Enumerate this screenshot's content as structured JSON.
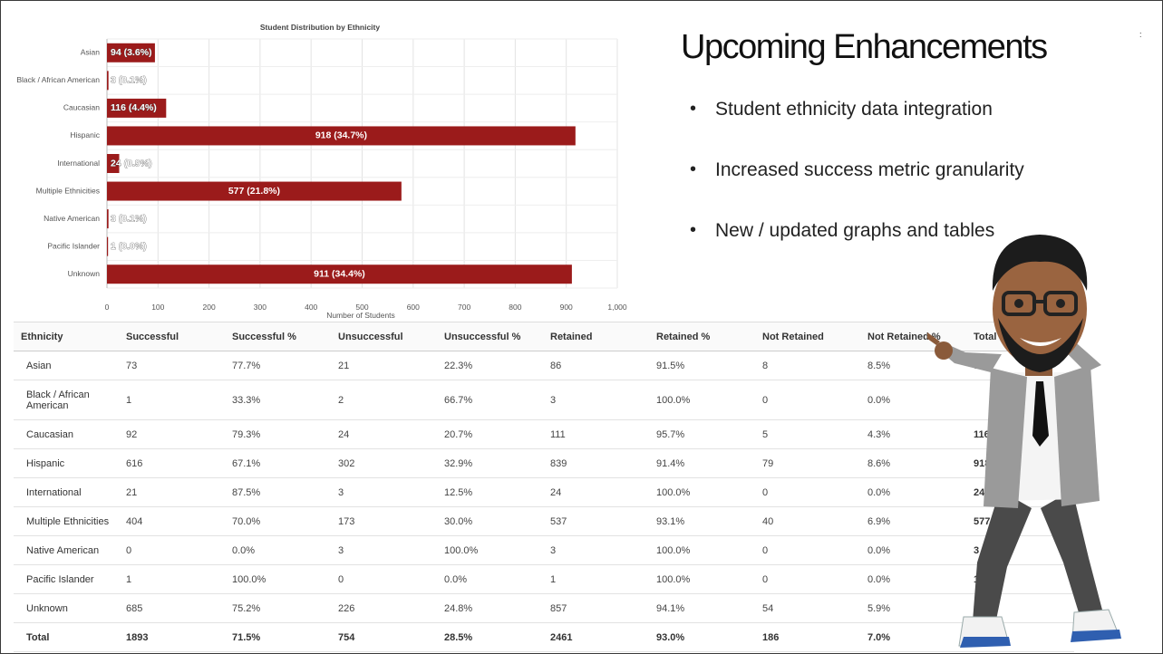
{
  "chart_data": {
    "type": "bar",
    "orientation": "horizontal",
    "title": "Student Distribution by Ethnicity",
    "xlabel": "Number of Students",
    "categories": [
      "Asian",
      "Black / African American",
      "Caucasian",
      "Hispanic",
      "International",
      "Multiple Ethnicities",
      "Native American",
      "Pacific Islander",
      "Unknown"
    ],
    "values": [
      94,
      3,
      116,
      918,
      24,
      577,
      3,
      1,
      911
    ],
    "data_labels": [
      "94 (3.6%)",
      "3 (0.1%)",
      "116 (4.4%)",
      "918 (34.7%)",
      "24 (0.9%)",
      "577 (21.8%)",
      "3 (0.1%)",
      "1 (0.0%)",
      "911 (34.4%)"
    ],
    "xlim": [
      0,
      1000
    ],
    "xticks": [
      "0",
      "100",
      "200",
      "300",
      "400",
      "500",
      "600",
      "700",
      "800",
      "900",
      "1,000"
    ],
    "grid": true,
    "bar_color": "#9b1b1b"
  },
  "slide": {
    "title": "Upcoming Enhancements",
    "bullets": [
      "Student ethnicity data integration",
      "Increased success metric granularity",
      "New / updated graphs and tables"
    ],
    "corner_mark": ":"
  },
  "table": {
    "headers": [
      "Ethnicity",
      "Successful",
      "Successful %",
      "Unsuccessful",
      "Unsuccessful %",
      "Retained",
      "Retained %",
      "Not Retained",
      "Not Retained %",
      "Total Students"
    ],
    "rows": [
      [
        "Asian",
        "73",
        "77.7%",
        "21",
        "22.3%",
        "86",
        "91.5%",
        "8",
        "8.5%",
        "94"
      ],
      [
        "Black / African American",
        "1",
        "33.3%",
        "2",
        "66.7%",
        "3",
        "100.0%",
        "0",
        "0.0%",
        ""
      ],
      [
        "Caucasian",
        "92",
        "79.3%",
        "24",
        "20.7%",
        "111",
        "95.7%",
        "5",
        "4.3%",
        "116"
      ],
      [
        "Hispanic",
        "616",
        "67.1%",
        "302",
        "32.9%",
        "839",
        "91.4%",
        "79",
        "8.6%",
        "918"
      ],
      [
        "International",
        "21",
        "87.5%",
        "3",
        "12.5%",
        "24",
        "100.0%",
        "0",
        "0.0%",
        "24"
      ],
      [
        "Multiple Ethnicities",
        "404",
        "70.0%",
        "173",
        "30.0%",
        "537",
        "93.1%",
        "40",
        "6.9%",
        "577"
      ],
      [
        "Native American",
        "0",
        "0.0%",
        "3",
        "100.0%",
        "3",
        "100.0%",
        "0",
        "0.0%",
        "3"
      ],
      [
        "Pacific Islander",
        "1",
        "100.0%",
        "0",
        "0.0%",
        "1",
        "100.0%",
        "0",
        "0.0%",
        "1"
      ],
      [
        "Unknown",
        "685",
        "75.2%",
        "226",
        "24.8%",
        "857",
        "94.1%",
        "54",
        "5.9%",
        "911"
      ],
      [
        "Total",
        "1893",
        "71.5%",
        "754",
        "28.5%",
        "2461",
        "93.0%",
        "186",
        "7.0%",
        ""
      ]
    ]
  }
}
